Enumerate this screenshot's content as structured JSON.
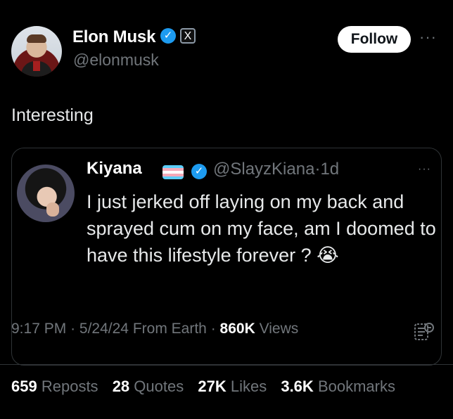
{
  "author": {
    "name": "Elon Musk",
    "handle": "@elonmusk",
    "follow_label": "Follow",
    "x_badge": "X",
    "verified_icon": "verified-icon"
  },
  "tweet": {
    "text": "Interesting"
  },
  "quote": {
    "name": "Kiyana",
    "handle": "@SlayzKiana",
    "separator": "·",
    "time": "1d",
    "text": "I just jerked off laying on my back and sprayed cum on my face, am I doomed to have this lifestyle forever ?",
    "emoji": "😭",
    "flag_icon": "trans-flag-icon",
    "more_label": "···"
  },
  "meta": {
    "time": "9:17 PM",
    "date": "5/24/24",
    "source": "From Earth",
    "views_count": "860K",
    "views_label": "Views",
    "sep": "·"
  },
  "stats": [
    {
      "count": "659",
      "label": "Reposts"
    },
    {
      "count": "28",
      "label": "Quotes"
    },
    {
      "count": "27K",
      "label": "Likes"
    },
    {
      "count": "3.6K",
      "label": "Bookmarks"
    }
  ],
  "ui": {
    "more_top": "···"
  },
  "colors": {
    "background": "#000000",
    "text": "#e7e9ea",
    "muted": "#71767b",
    "accent": "#1d9bf0",
    "border": "#2f3336"
  }
}
